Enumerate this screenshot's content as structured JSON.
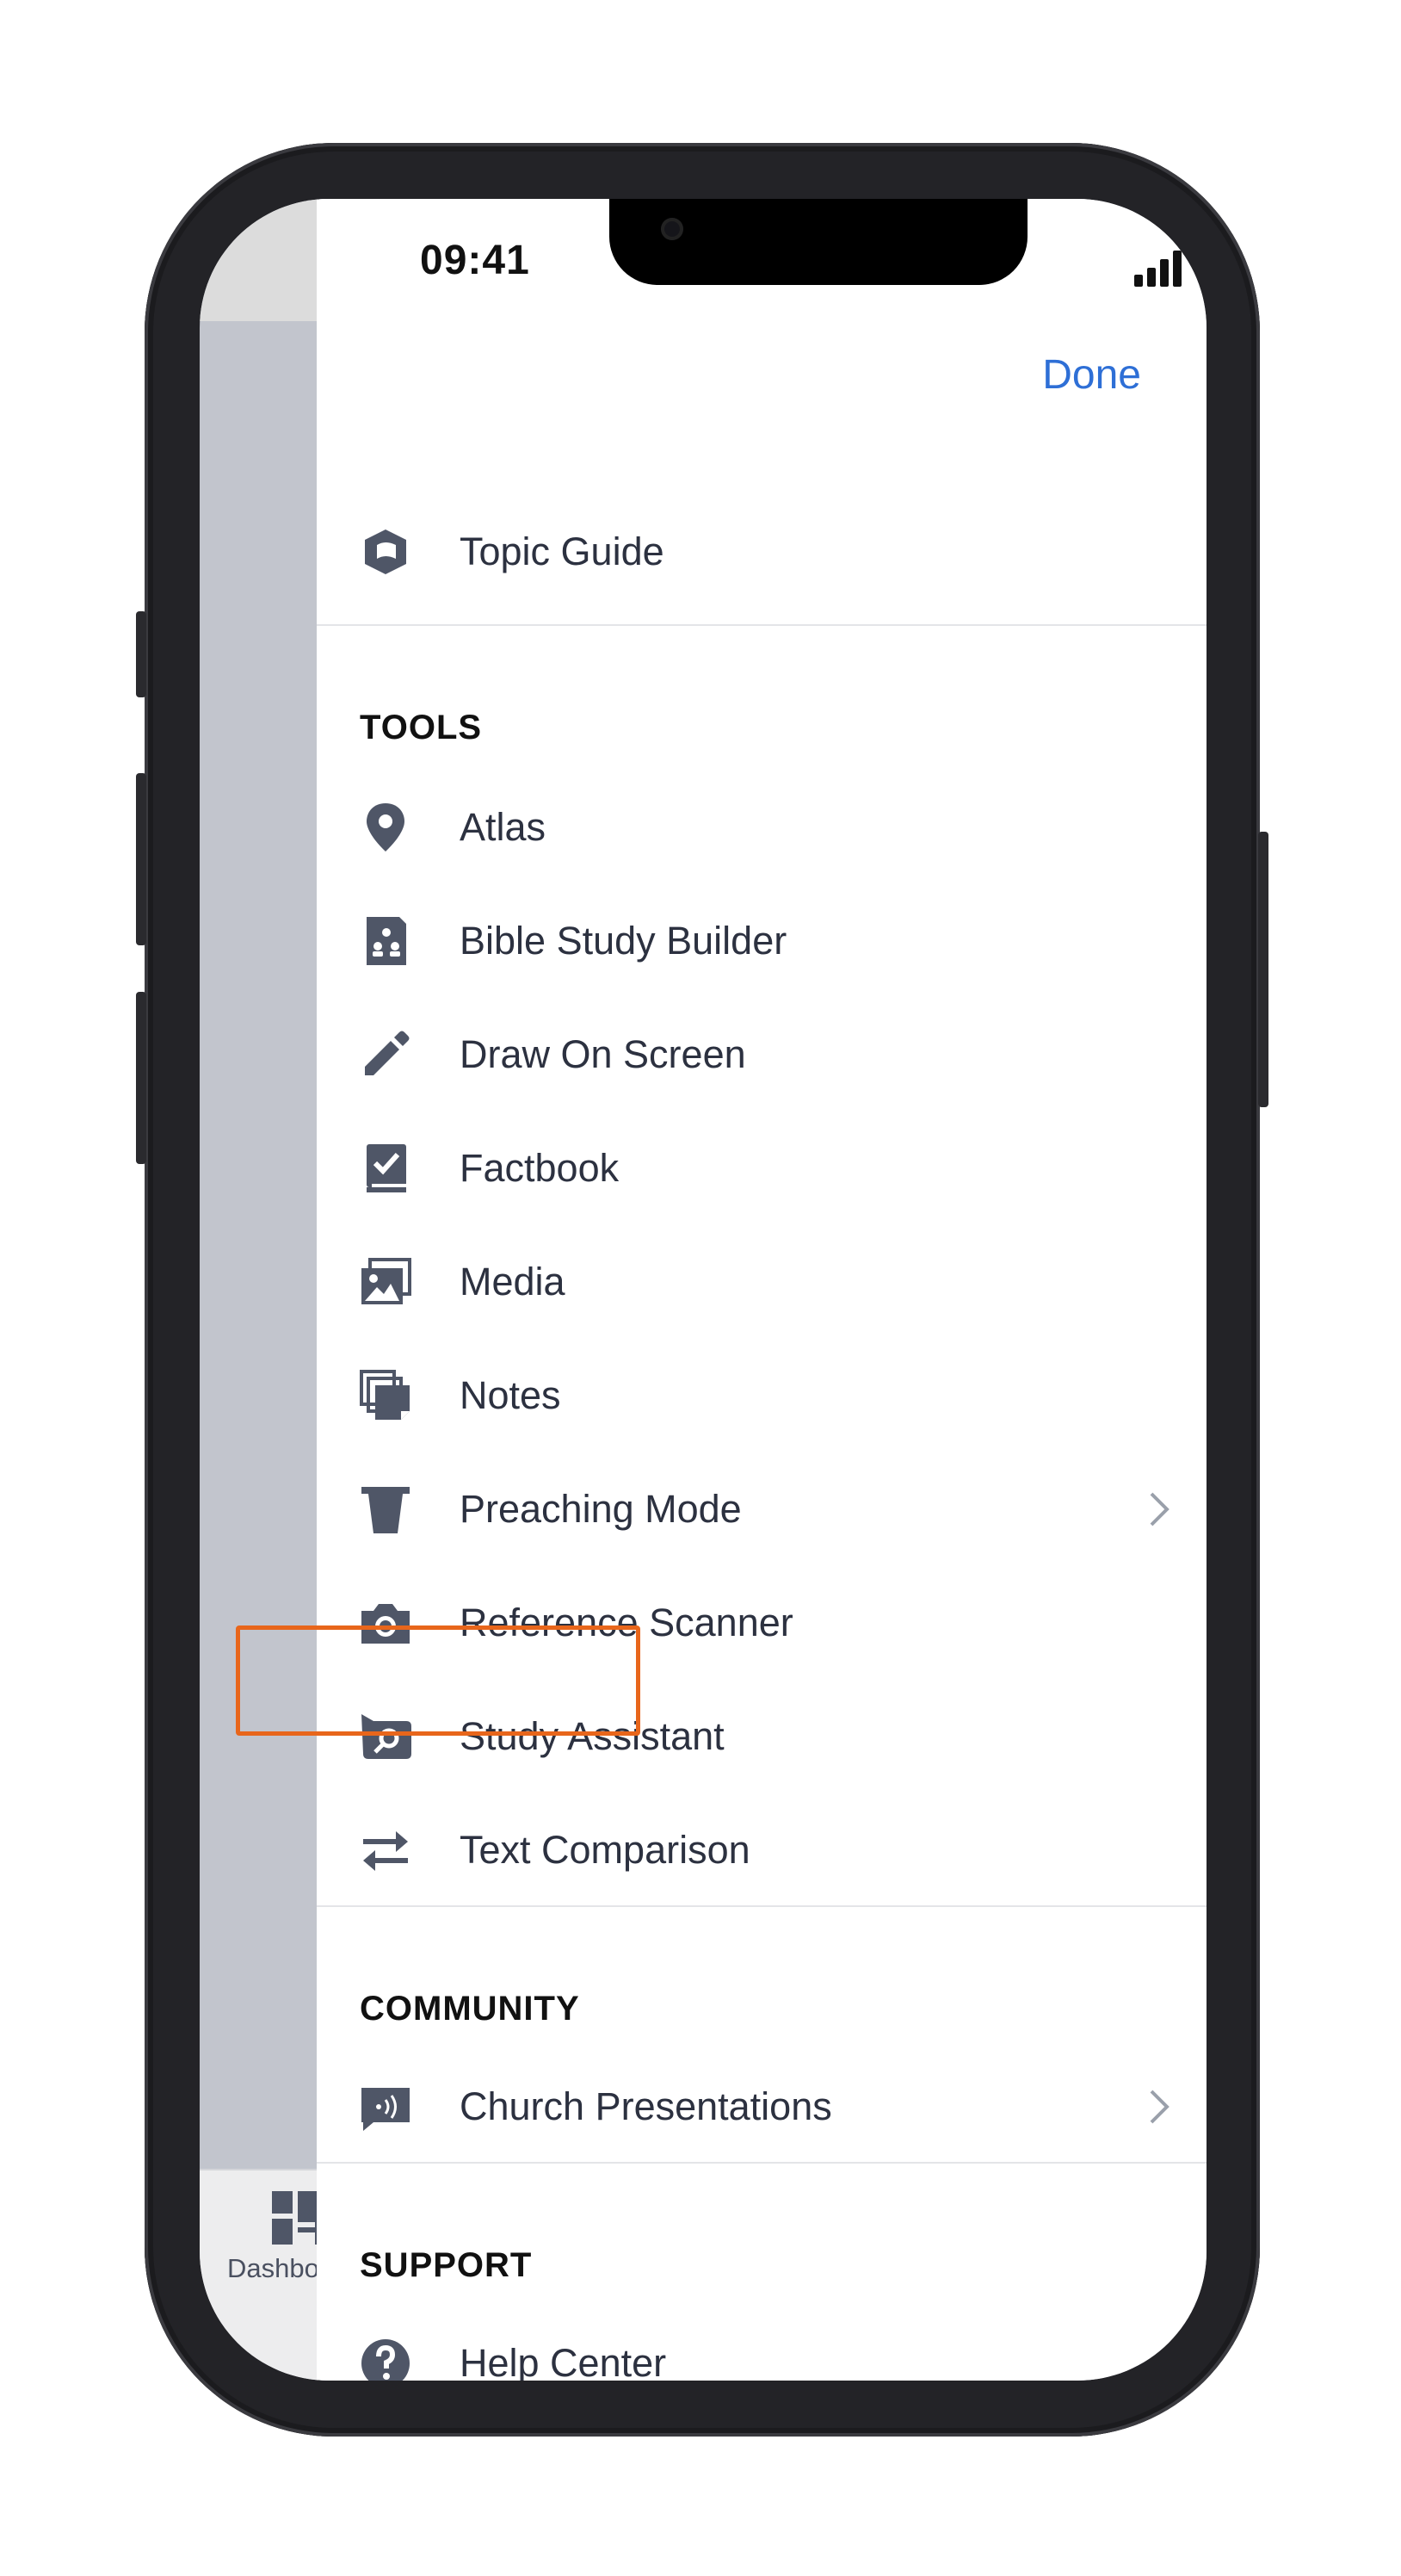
{
  "status_bar": {
    "time": "09:41"
  },
  "header": {
    "done_label": "Done"
  },
  "background_tab": {
    "label": "Dashboard"
  },
  "top_item": {
    "label": "Topic Guide",
    "icon": "topic-guide-icon"
  },
  "sections": {
    "tools": {
      "title": "TOOLS",
      "items": [
        {
          "label": "Atlas",
          "icon": "map-pin-icon"
        },
        {
          "label": "Bible Study Builder",
          "icon": "study-builder-icon"
        },
        {
          "label": "Draw On Screen",
          "icon": "pencil-icon"
        },
        {
          "label": "Factbook",
          "icon": "factbook-icon"
        },
        {
          "label": "Media",
          "icon": "media-icon"
        },
        {
          "label": "Notes",
          "icon": "notes-icon"
        },
        {
          "label": "Preaching Mode",
          "icon": "podium-icon",
          "has_chevron": true
        },
        {
          "label": "Reference Scanner",
          "icon": "camera-icon"
        },
        {
          "label": "Study Assistant",
          "icon": "study-assistant-icon",
          "highlighted": true
        },
        {
          "label": "Text Comparison",
          "icon": "swap-arrows-icon"
        }
      ]
    },
    "community": {
      "title": "COMMUNITY",
      "items": [
        {
          "label": "Church Presentations",
          "icon": "presentation-icon",
          "has_chevron": true
        }
      ]
    },
    "support": {
      "title": "SUPPORT",
      "items": [
        {
          "label": "Help Center",
          "icon": "help-icon"
        }
      ]
    }
  },
  "colors": {
    "accent": "#2e6fd6",
    "icon": "#4f5667",
    "text": "#2c3140",
    "highlight": "#e8661b"
  }
}
